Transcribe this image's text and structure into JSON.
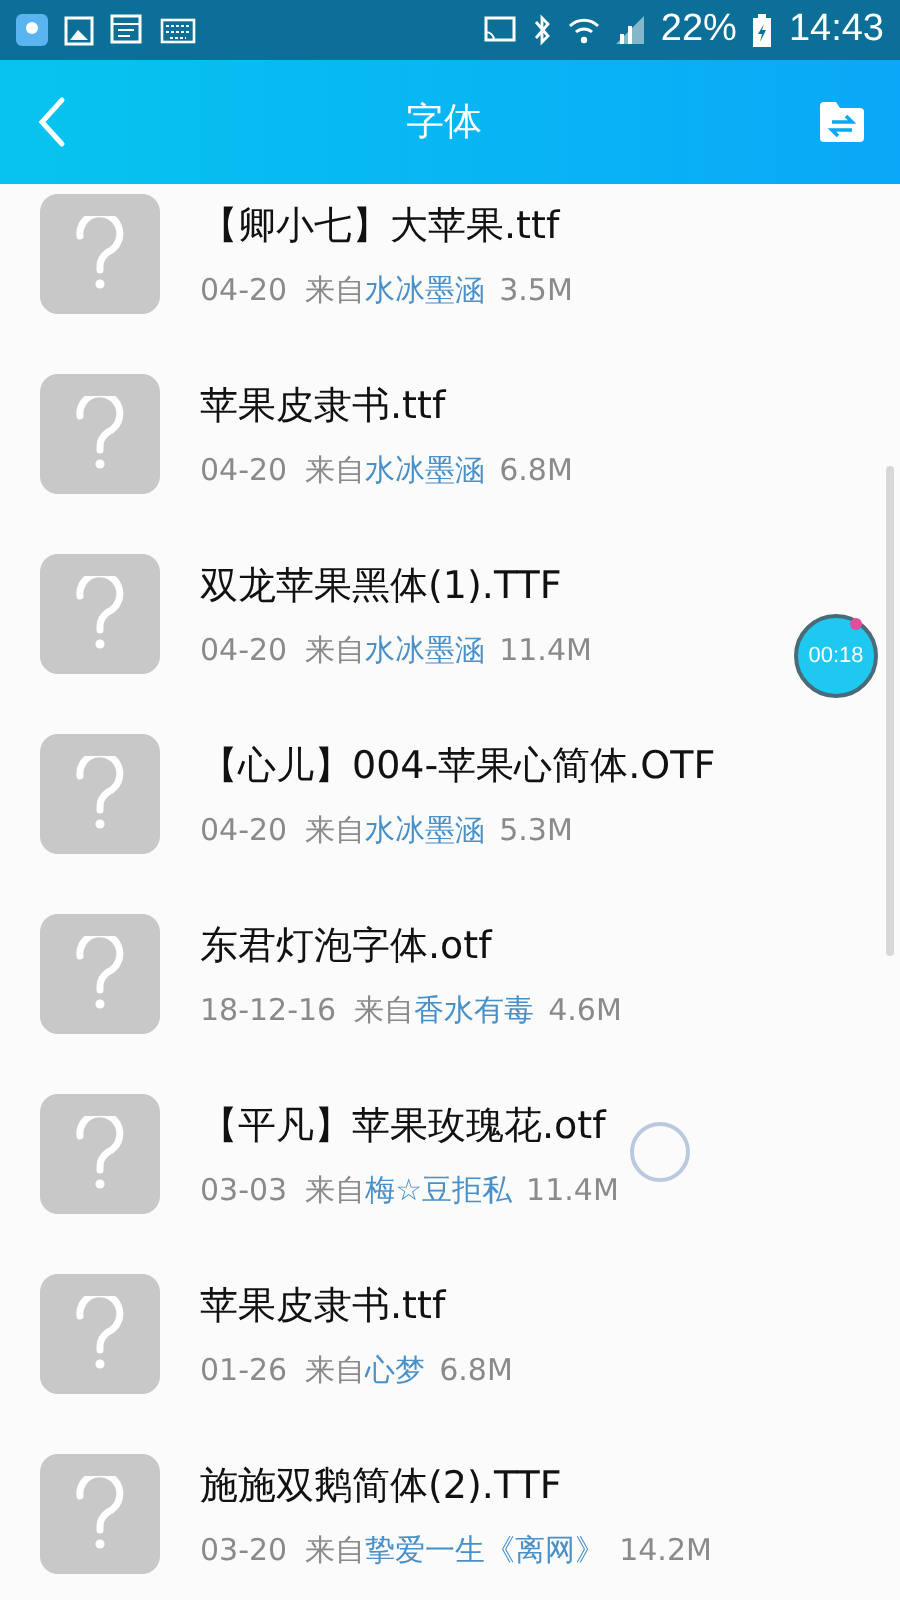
{
  "status_bar": {
    "battery": "22%",
    "time": "14:43"
  },
  "header": {
    "title": "字体"
  },
  "files": [
    {
      "name": "【卿小七】大苹果.ttf",
      "date": "04-20",
      "from": "来自",
      "source": "水冰墨涵",
      "size": "3.5M"
    },
    {
      "name": "苹果皮隶书.ttf",
      "date": "04-20",
      "from": "来自",
      "source": "水冰墨涵",
      "size": "6.8M"
    },
    {
      "name": "双龙苹果黑体(1).TTF",
      "date": "04-20",
      "from": "来自",
      "source": "水冰墨涵",
      "size": "11.4M"
    },
    {
      "name": "【心儿】004-苹果心简体.OTF",
      "date": "04-20",
      "from": "来自",
      "source": "水冰墨涵",
      "size": "5.3M"
    },
    {
      "name": "东君灯泡字体.otf",
      "date": "18-12-16",
      "from": "来自",
      "source": "香水有毒",
      "size": "4.6M"
    },
    {
      "name": "【平凡】苹果玫瑰花.otf",
      "date": "03-03",
      "from": "来自",
      "source": "梅☆豆拒私",
      "size": "11.4M"
    },
    {
      "name": "苹果皮隶书.ttf",
      "date": "01-26",
      "from": "来自",
      "source": "心梦",
      "size": "6.8M"
    },
    {
      "name": "施施双鹅简体(2).TTF",
      "date": "03-20",
      "from": "来自",
      "source": "挚爱一生《离网》",
      "size": "14.2M"
    }
  ],
  "timer": {
    "time": "00:18"
  }
}
